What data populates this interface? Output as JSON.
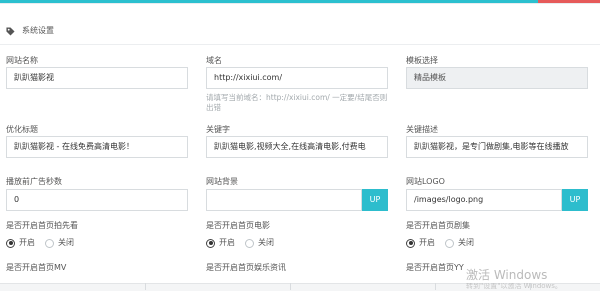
{
  "section": {
    "title": "系统设置",
    "icon": "tag-icon"
  },
  "fields": {
    "site_name": {
      "label": "网站名称",
      "value": "趴趴猫影视"
    },
    "domain": {
      "label": "域名",
      "value": "http://xixiui.com/",
      "hint": "请填写当前域名：http://xixiui.com/ 一定要/结尾否则出错"
    },
    "template": {
      "label": "模板选择",
      "value": "精品模板"
    },
    "seo_title": {
      "label": "优化标题",
      "value": "趴趴猫影视 - 在线免费高清电影！"
    },
    "keywords": {
      "label": "关键字",
      "value": "趴趴猫电影,视频大全,在线高清电影,付费电"
    },
    "description": {
      "label": "关键描述",
      "value": "趴趴猫影视，是专门做剧集,电影等在线播放"
    },
    "pre_ad_seconds": {
      "label": "播放前广告秒数",
      "value": "0"
    },
    "background": {
      "label": "网站背景",
      "value": "",
      "button": "UP"
    },
    "logo": {
      "label": "网站LOGO",
      "value": "/images/logo.png",
      "button": "UP"
    }
  },
  "toggles": [
    {
      "label": "是否开启首页拍先看",
      "on_label": "开启",
      "off_label": "关闭",
      "selected": "on"
    },
    {
      "label": "是否开启首页电影",
      "on_label": "开启",
      "off_label": "关闭",
      "selected": "on"
    },
    {
      "label": "是否开启首页剧集",
      "on_label": "开启",
      "off_label": "关闭",
      "selected": "on"
    }
  ],
  "more_toggles": [
    {
      "label": "是否开启首页MV"
    },
    {
      "label": "是否开启首页娱乐资讯"
    },
    {
      "label": "是否开启首页YY"
    }
  ],
  "watermark": {
    "title": "激活 Windows",
    "subtitle": "转到\"设置\"以激活 Windows。"
  },
  "colors": {
    "accent": "#2dbdcd",
    "top_bar": "#2cc0cf",
    "danger": "#e65a5a"
  }
}
